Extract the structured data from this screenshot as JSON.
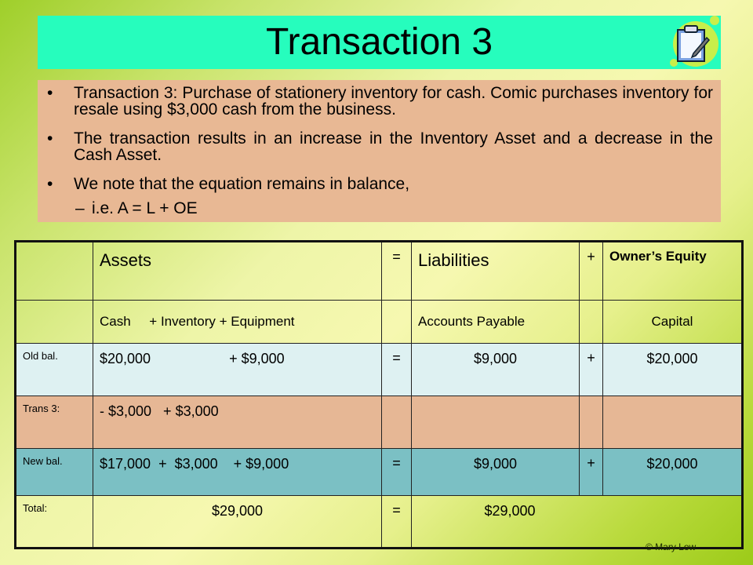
{
  "slide": {
    "title": "Transaction 3",
    "icon": "clipboard-pencil-icon",
    "colors": {
      "title_bg": "#26fdbd",
      "bullet_bg": "#e8b894",
      "old_bal_row": "#def1f2",
      "trans_row": "#e6b795",
      "new_bal_row": "#7bc0c4"
    },
    "bullets": [
      "Transaction 3: Purchase of stationery inventory for cash. Comic purchases inventory for resale using $3,000 cash from the business.",
      "The transaction results in an increase in the Inventory Asset and a decrease in the Cash Asset.",
      "We note that the equation remains in balance,"
    ],
    "sub_bullet": "i.e. A = L + OE",
    "copyright": "© Mary Low"
  },
  "table": {
    "header": {
      "assets": "Assets",
      "eq": "=",
      "liabilities": "Liabilities",
      "plus": "+",
      "owners_equity": "Owner’s Equity"
    },
    "subheader": {
      "assets": "Cash     + Inventory + Equipment",
      "liabilities": "Accounts Payable",
      "owners_equity": "Capital"
    },
    "rows": [
      {
        "label": "Old bal.",
        "assets": "$20,000                    + $9,000",
        "eq": "=",
        "liabilities": "$9,000",
        "plus": "+",
        "owners_equity": "$20,000"
      },
      {
        "label": "Trans 3:",
        "assets": "- $3,000   + $3,000",
        "eq": "",
        "liabilities": "",
        "plus": "",
        "owners_equity": ""
      },
      {
        "label": "New bal.",
        "assets": "$17,000  +  $3,000    + $9,000",
        "eq": "=",
        "liabilities": "$9,000",
        "plus": "+",
        "owners_equity": "$20,000"
      },
      {
        "label": "Total:",
        "assets": "$29,000",
        "eq": "=",
        "right_total": "$29,000"
      }
    ]
  }
}
